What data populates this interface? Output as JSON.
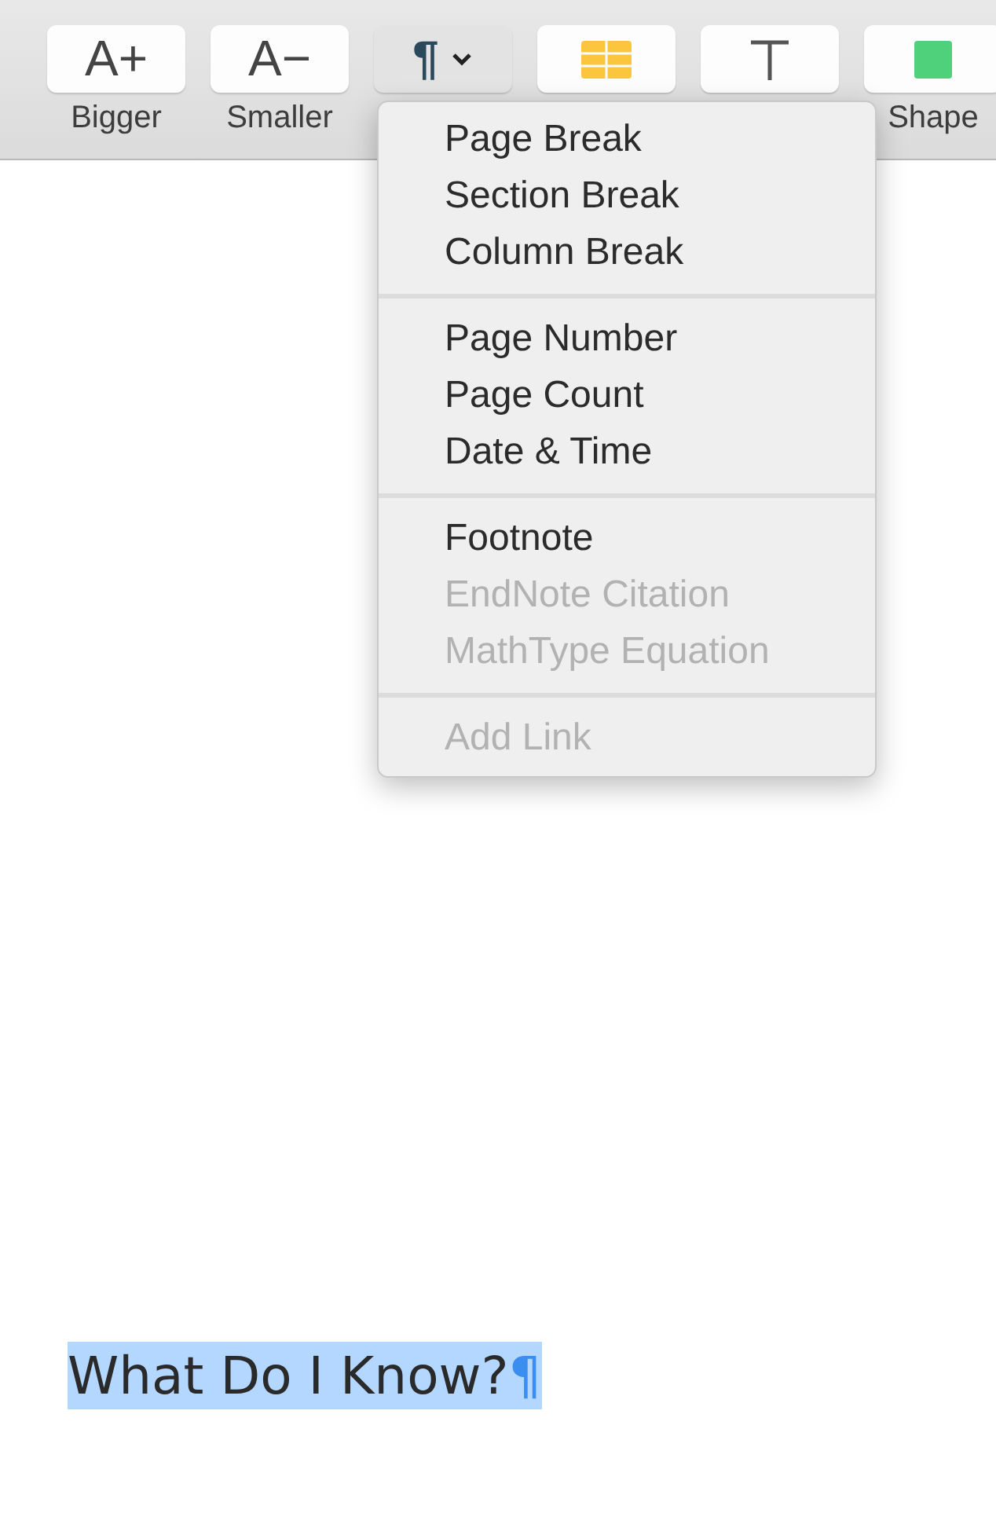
{
  "toolbar": {
    "buttons": [
      {
        "kind": "glyph",
        "glyph": "A+",
        "label": "Bigger",
        "pressed": false
      },
      {
        "kind": "glyph",
        "glyph": "A−",
        "label": "Smaller",
        "pressed": false
      },
      {
        "kind": "pilcrow",
        "glyph": "¶",
        "pressed": true
      },
      {
        "kind": "table",
        "pressed": false
      },
      {
        "kind": "text",
        "pressed": false
      },
      {
        "kind": "shape",
        "label": "Shape",
        "pressed": false
      }
    ]
  },
  "menu": {
    "sections": [
      [
        {
          "label": "Page Break",
          "disabled": false
        },
        {
          "label": "Section Break",
          "disabled": false
        },
        {
          "label": "Column Break",
          "disabled": false
        }
      ],
      [
        {
          "label": "Page Number",
          "disabled": false
        },
        {
          "label": "Page Count",
          "disabled": false
        },
        {
          "label": "Date & Time",
          "disabled": false
        }
      ],
      [
        {
          "label": "Footnote",
          "disabled": false
        },
        {
          "label": "EndNote Citation",
          "disabled": true
        },
        {
          "label": "MathType Equation",
          "disabled": true
        }
      ],
      [
        {
          "label": "Add Link",
          "disabled": true
        }
      ]
    ]
  },
  "document": {
    "heading": "What Do I Know?",
    "pilcrow": "¶",
    "selected": true
  }
}
